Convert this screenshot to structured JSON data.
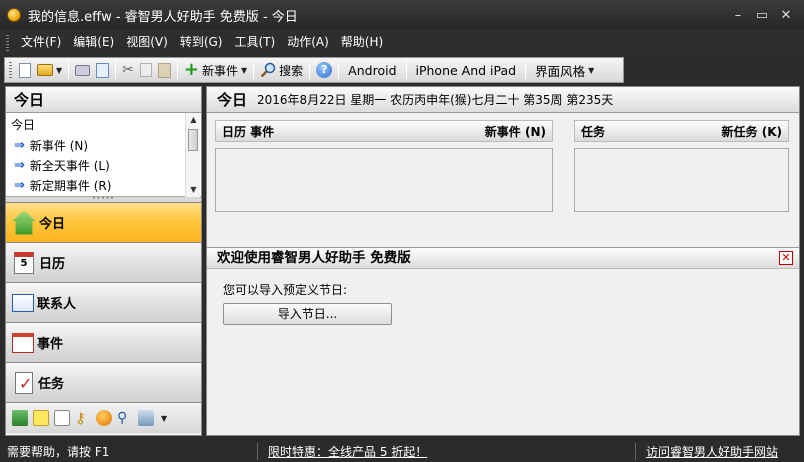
{
  "window": {
    "title": "我的信息.effw - 睿智男人好助手 免费版 - 今日",
    "minimize": "–",
    "restore": "▭",
    "close": "✕"
  },
  "menu": [
    "文件(F)",
    "编辑(E)",
    "视图(V)",
    "转到(G)",
    "工具(T)",
    "动作(A)",
    "帮助(H)"
  ],
  "toolbar": {
    "new_event": "新事件",
    "search": "搜索",
    "android": "Android",
    "iphone": "iPhone And iPad",
    "theme": "界面风格"
  },
  "left": {
    "title": "今日",
    "list_title": "今日",
    "quick_items": [
      "新事件 (N)",
      "新全天事件 (L)",
      "新定期事件 (R)"
    ],
    "nav": [
      "今日",
      "日历",
      "联系人",
      "事件",
      "任务"
    ],
    "calendar_day": "5"
  },
  "right": {
    "title": "今日",
    "date_line": "2016年8月22日 星期一 农历丙申年(猴)七月二十  第35周 第235天",
    "calendar_pane": {
      "left": "日历  事件",
      "right": "新事件 (N)"
    },
    "task_pane": {
      "left": "任务",
      "right": "新任务 (K)"
    },
    "welcome_title": "欢迎使用睿智男人好助手 免费版",
    "welcome_close": "✕",
    "welcome_text": "您可以导入预定义节日:",
    "import_button": "导入节日..."
  },
  "status": {
    "help": "需要帮助，请按 F1",
    "promo": "限时特惠：全线产品 5 折起！",
    "visit": "访问睿智男人好助手网站"
  },
  "colors": {
    "active_nav": "#ffc43a",
    "chrome": "#2b2b2b"
  }
}
